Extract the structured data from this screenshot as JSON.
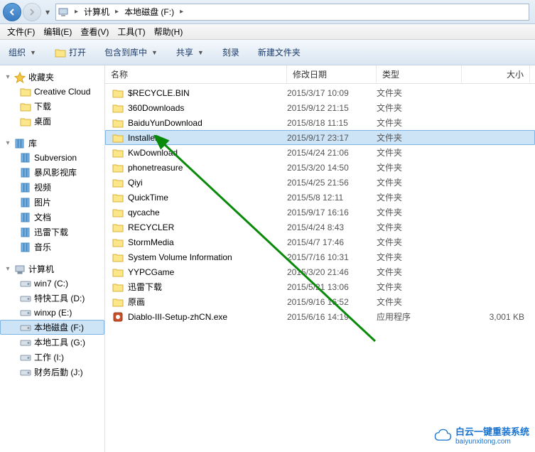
{
  "breadcrumb": {
    "root": "计算机",
    "drive": "本地磁盘 (F:)"
  },
  "menu": {
    "file": "文件(F)",
    "edit": "编辑(E)",
    "view": "查看(V)",
    "tools": "工具(T)",
    "help": "帮助(H)"
  },
  "toolbar": {
    "organize": "组织",
    "open": "打开",
    "include": "包含到库中",
    "share": "共享",
    "burn": "刻录",
    "newfolder": "新建文件夹"
  },
  "columns": {
    "name": "名称",
    "date": "修改日期",
    "type": "类型",
    "size": "大小"
  },
  "nav": {
    "favorites": {
      "label": "收藏夹",
      "items": [
        {
          "label": "Creative Cloud",
          "icon": "folder"
        },
        {
          "label": "下载",
          "icon": "folder"
        },
        {
          "label": "桌面",
          "icon": "folder"
        }
      ]
    },
    "libraries": {
      "label": "库",
      "items": [
        {
          "label": "Subversion",
          "icon": "lib"
        },
        {
          "label": "暴风影视库",
          "icon": "lib"
        },
        {
          "label": "视频",
          "icon": "lib"
        },
        {
          "label": "图片",
          "icon": "lib"
        },
        {
          "label": "文档",
          "icon": "lib"
        },
        {
          "label": "迅雷下载",
          "icon": "lib"
        },
        {
          "label": "音乐",
          "icon": "lib"
        }
      ]
    },
    "computer": {
      "label": "计算机",
      "items": [
        {
          "label": "win7 (C:)",
          "icon": "drive"
        },
        {
          "label": "特快工具 (D:)",
          "icon": "drive"
        },
        {
          "label": "winxp (E:)",
          "icon": "drive"
        },
        {
          "label": "本地磁盘 (F:)",
          "icon": "drive",
          "selected": true
        },
        {
          "label": "本地工具 (G:)",
          "icon": "drive"
        },
        {
          "label": "工作 (I:)",
          "icon": "drive"
        },
        {
          "label": "财务后勤 (J:)",
          "icon": "drive"
        }
      ]
    }
  },
  "files": [
    {
      "name": "$RECYCLE.BIN",
      "date": "2015/3/17 10:09",
      "type": "文件夹",
      "size": "",
      "icon": "folder"
    },
    {
      "name": "360Downloads",
      "date": "2015/9/12 21:15",
      "type": "文件夹",
      "size": "",
      "icon": "folder"
    },
    {
      "name": "BaiduYunDownload",
      "date": "2015/8/18 11:15",
      "type": "文件夹",
      "size": "",
      "icon": "folder"
    },
    {
      "name": "Installer",
      "date": "2015/9/17 23:17",
      "type": "文件夹",
      "size": "",
      "icon": "folder",
      "selected": true
    },
    {
      "name": "KwDownload",
      "date": "2015/4/24 21:06",
      "type": "文件夹",
      "size": "",
      "icon": "folder"
    },
    {
      "name": "phonetreasure",
      "date": "2015/3/20 14:50",
      "type": "文件夹",
      "size": "",
      "icon": "folder"
    },
    {
      "name": "Qiyi",
      "date": "2015/4/25 21:56",
      "type": "文件夹",
      "size": "",
      "icon": "folder"
    },
    {
      "name": "QuickTime",
      "date": "2015/5/8 12:11",
      "type": "文件夹",
      "size": "",
      "icon": "folder"
    },
    {
      "name": "qycache",
      "date": "2015/9/17 16:16",
      "type": "文件夹",
      "size": "",
      "icon": "folder"
    },
    {
      "name": "RECYCLER",
      "date": "2015/4/24 8:43",
      "type": "文件夹",
      "size": "",
      "icon": "folder"
    },
    {
      "name": "StormMedia",
      "date": "2015/4/7 17:46",
      "type": "文件夹",
      "size": "",
      "icon": "folder"
    },
    {
      "name": "System Volume Information",
      "date": "2015/7/16 10:31",
      "type": "文件夹",
      "size": "",
      "icon": "folder"
    },
    {
      "name": "YYPCGame",
      "date": "2015/3/20 21:46",
      "type": "文件夹",
      "size": "",
      "icon": "folder"
    },
    {
      "name": "迅雷下载",
      "date": "2015/5/21 13:06",
      "type": "文件夹",
      "size": "",
      "icon": "folder"
    },
    {
      "name": "原画",
      "date": "2015/9/16 16:52",
      "type": "文件夹",
      "size": "",
      "icon": "folder"
    },
    {
      "name": "Diablo-III-Setup-zhCN.exe",
      "date": "2015/6/16 14:19",
      "type": "应用程序",
      "size": "3,001 KB",
      "icon": "exe"
    }
  ],
  "watermark": {
    "main": "白云一键重装系统",
    "sub": "baiyunxitong.com"
  }
}
